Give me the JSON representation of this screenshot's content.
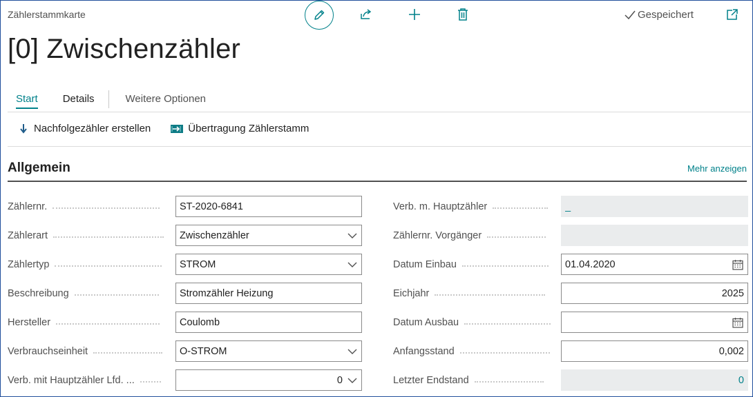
{
  "header": {
    "card_label": "Zählerstammkarte",
    "title": "[0] Zwischenzähler",
    "saved_label": "Gespeichert"
  },
  "tabs": [
    {
      "label": "Start",
      "active": true
    },
    {
      "label": "Details",
      "active": false
    },
    {
      "label": "Weitere Optionen",
      "active": false
    }
  ],
  "actions": {
    "successor": "Nachfolgezähler erstellen",
    "transfer": "Übertragung Zählerstamm"
  },
  "section": {
    "title": "Allgemein",
    "more_link": "Mehr anzeigen"
  },
  "left_fields": [
    {
      "label": "Zählernr.",
      "value": "ST-2020-6841",
      "type": "text"
    },
    {
      "label": "Zählerart",
      "value": "Zwischenzähler",
      "type": "select"
    },
    {
      "label": "Zählertyp",
      "value": "STROM",
      "type": "select"
    },
    {
      "label": "Beschreibung",
      "value": "Stromzähler Heizung",
      "type": "text"
    },
    {
      "label": "Hersteller",
      "value": "Coulomb",
      "type": "text"
    },
    {
      "label": "Verbrauchseinheit",
      "value": "O-STROM",
      "type": "select"
    },
    {
      "label": "Verb. mit Hauptzähler Lfd. ...",
      "value": "0",
      "type": "select-number"
    }
  ],
  "right_fields": [
    {
      "label": "Verb. m. Hauptzähler",
      "value": "_",
      "type": "readonly"
    },
    {
      "label": "Zählernr. Vorgänger",
      "value": "",
      "type": "readonly"
    },
    {
      "label": "Datum Einbau",
      "value": "01.04.2020",
      "type": "date"
    },
    {
      "label": "Eichjahr",
      "value": "2025",
      "type": "number"
    },
    {
      "label": "Datum Ausbau",
      "value": "",
      "type": "date"
    },
    {
      "label": "Anfangsstand",
      "value": "0,002",
      "type": "number"
    },
    {
      "label": "Letzter Endstand",
      "value": "0",
      "type": "readonly-number"
    }
  ],
  "colors": {
    "accent": "#00818a",
    "frame": "#1f4e9b",
    "readonly_bg": "#eaeced"
  },
  "icons": [
    "edit-icon",
    "share-icon",
    "new-icon",
    "delete-icon",
    "checkmark-icon",
    "open-new-window-icon",
    "arrow-down-icon",
    "transfer-icon",
    "chevron-down-icon",
    "calendar-icon"
  ]
}
